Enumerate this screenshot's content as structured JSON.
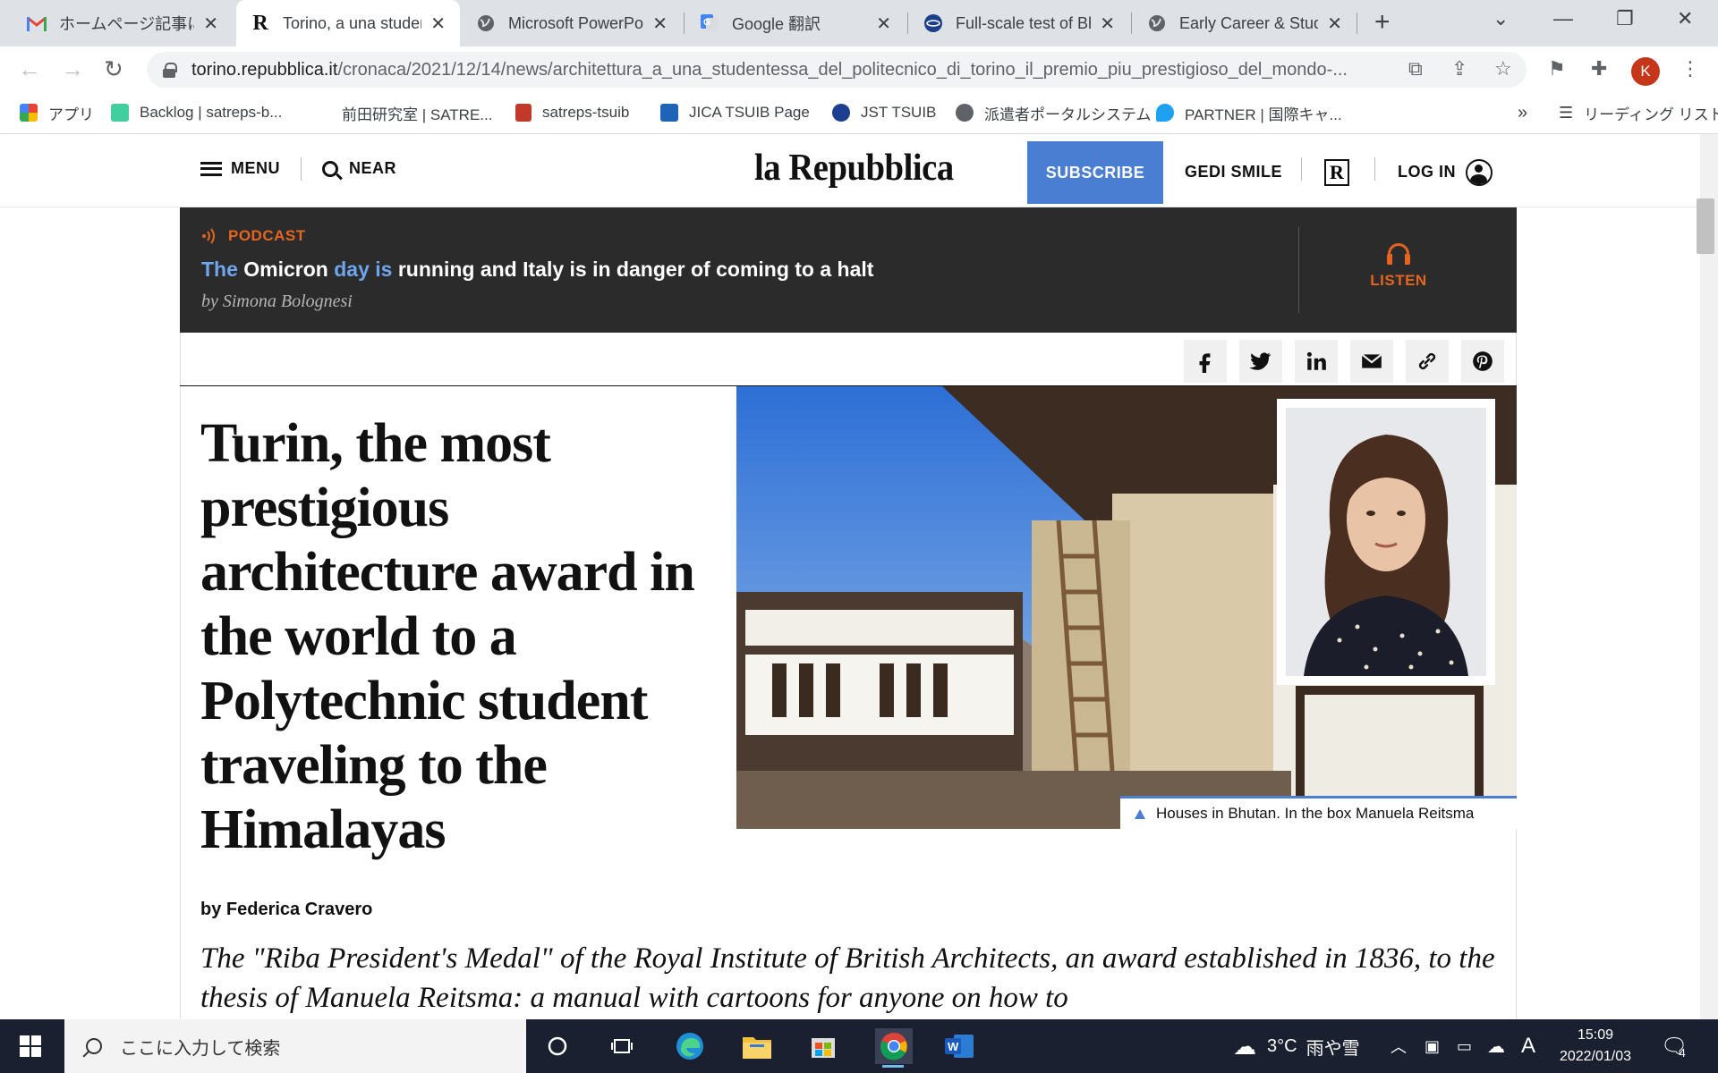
{
  "browser": {
    "tabs": [
      {
        "label": "ホームページ記事につい",
        "favicon": "gmail-icon",
        "active": false
      },
      {
        "label": "Torino, a una studen",
        "favicon": "R",
        "active": true
      },
      {
        "label": "Microsoft PowerPo",
        "favicon": "globe-icon",
        "active": false
      },
      {
        "label": "Google 翻訳",
        "favicon": "google-translate-icon",
        "active": false
      },
      {
        "label": "Full-scale test of Bh",
        "favicon": "site-icon",
        "active": false
      },
      {
        "label": "Early Career & Stud",
        "favicon": "globe-icon",
        "active": false
      }
    ],
    "url_host": "torino.repubblica.it",
    "url_path": "/cronaca/2021/12/14/news/architettura_a_una_studentessa_del_politecnico_di_torino_il_premio_piu_prestigioso_del_mondo-...",
    "profile_initial": "K",
    "bookmarks": [
      "アプリ",
      "Backlog | satreps-b...",
      "前田研究室 | SATRE...",
      "satreps-tsuib",
      "JICA TSUIB Page",
      "JST TSUIB",
      "派遣者ポータルシステム",
      "PARTNER | 国際キャ..."
    ],
    "reading_list": "リーディング リスト",
    "bookmarks_overflow": "»"
  },
  "site": {
    "menu_label": "MENU",
    "near_label": "NEAR",
    "logo": "la Repubblica",
    "subscribe_label": "SUBSCRIBE",
    "gedi_label": "GEDI SMILE",
    "r_label": "R",
    "login_label": "LOG IN"
  },
  "podcast": {
    "label": "PODCAST",
    "title_parts": [
      "The",
      " Omicron ",
      "day is",
      " running and Italy is in danger of coming to a halt"
    ],
    "author": "by Simona Bolognesi",
    "listen_label": "LISTEN"
  },
  "share": [
    "facebook-icon",
    "twitter-icon",
    "linkedin-icon",
    "mail-icon",
    "link-icon",
    "pinterest-icon"
  ],
  "article": {
    "headline": "Turin, the most prestigious architecture award in the world to a Polytechnic student traveling to the Himalayas",
    "caption": "Houses in Bhutan. In the box Manuela Reitsma",
    "byline_prefix": "by",
    "byline_author": "Federica Cravero",
    "lede": "The \"Riba President's Medal\" of the Royal Institute of British Architects, an award established in 1836, to the thesis of Manuela Reitsma: a manual with cartoons for anyone on how to"
  },
  "taskbar": {
    "search_placeholder": "ここに入力して検索",
    "weather_temp": "3°C",
    "weather_text": "雨や雪",
    "ime": "A",
    "time": "15:09",
    "date": "2022/01/03",
    "notifications": "4"
  },
  "colors": {
    "accent_blue": "#4a7ed3",
    "podcast_orange": "#e4651f",
    "podcast_bg": "#2b2b2b"
  }
}
